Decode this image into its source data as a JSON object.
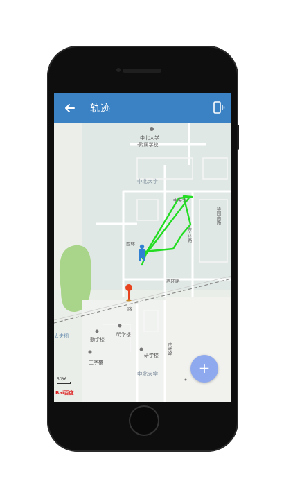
{
  "appbar": {
    "title": "轨迹",
    "back_icon": "arrow-left-icon",
    "action_icon": "phone-vibrate-icon",
    "color": "#3b82c4"
  },
  "map": {
    "labels": {
      "school_line1": "中北大学",
      "school_line2": "-附属学校",
      "campus": "中北大学",
      "campus_bottom": "中北大学",
      "road_zhongyang": "中央大",
      "road_xihuan": "西环",
      "road_xihuan2": "西环路",
      "road_dongxiang": "东·环路",
      "road_huayuan": "华园南路",
      "road_nanhuan": "南环路",
      "building_shixue": "勤学楼",
      "building_mingxue": "明学楼",
      "building_xuexue": "研学楼",
      "building_gongzi": "工字楼",
      "road_left": "太夫祠",
      "road_small": "路"
    },
    "track_color": "#22dd22",
    "scale_text": "50米",
    "logo_text": "Bai百度"
  },
  "fab": {
    "label": "+",
    "icon": "plus-icon"
  }
}
